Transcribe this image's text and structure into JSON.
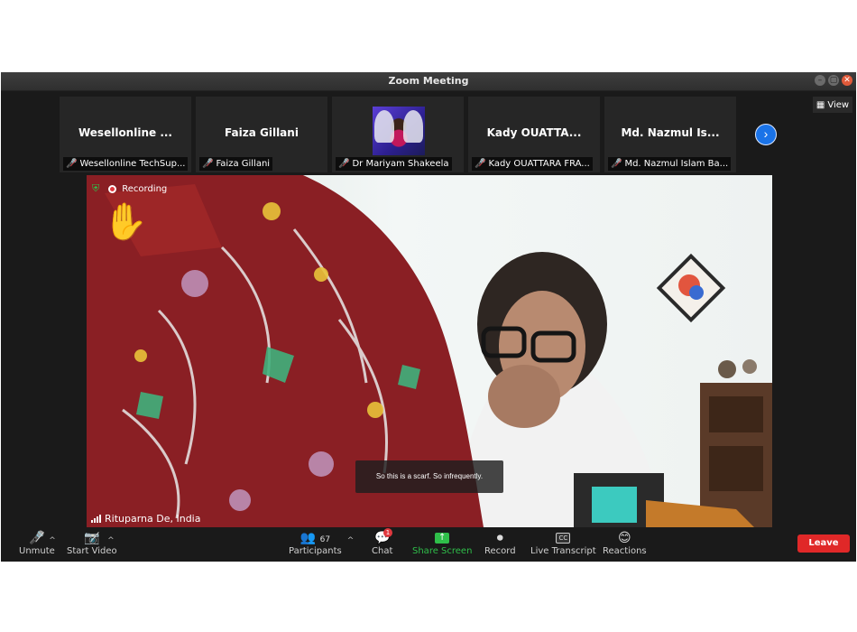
{
  "window": {
    "title": "Zoom Meeting"
  },
  "view_button": {
    "label": "View"
  },
  "participants_strip": [
    {
      "display": "Wesellonline ...",
      "name": "Wesellonline TechSup...",
      "muted": true
    },
    {
      "display": "Faiza Gillani",
      "name": "Faiza Gillani",
      "muted": true
    },
    {
      "display": "",
      "name": "Dr Mariyam Shakeela",
      "muted": true,
      "has_photo": true
    },
    {
      "display": "Kady OUATTA...",
      "name": "Kady OUATTARA FRA...",
      "muted": true
    },
    {
      "display": "Md. Nazmul Is...",
      "name": "Md. Nazmul Islam Ba...",
      "muted": true
    }
  ],
  "active_speaker": {
    "recording_label": "Recording",
    "caption": "So this is a scarf. So infrequently.",
    "name": "Rituparna De, India"
  },
  "toolbar": {
    "unmute": "Unmute",
    "start_video": "Start Video",
    "participants_label": "Participants",
    "participants_count": "67",
    "chat": "Chat",
    "chat_badge": "1",
    "share_screen": "Share Screen",
    "record": "Record",
    "live_transcript": "Live Transcript",
    "cc_icon": "CC",
    "reactions": "Reactions",
    "leave": "Leave"
  },
  "colors": {
    "share": "#2fbf4a",
    "leave": "#e02828",
    "nav": "#1a73e8",
    "mute": "#e0383e"
  }
}
